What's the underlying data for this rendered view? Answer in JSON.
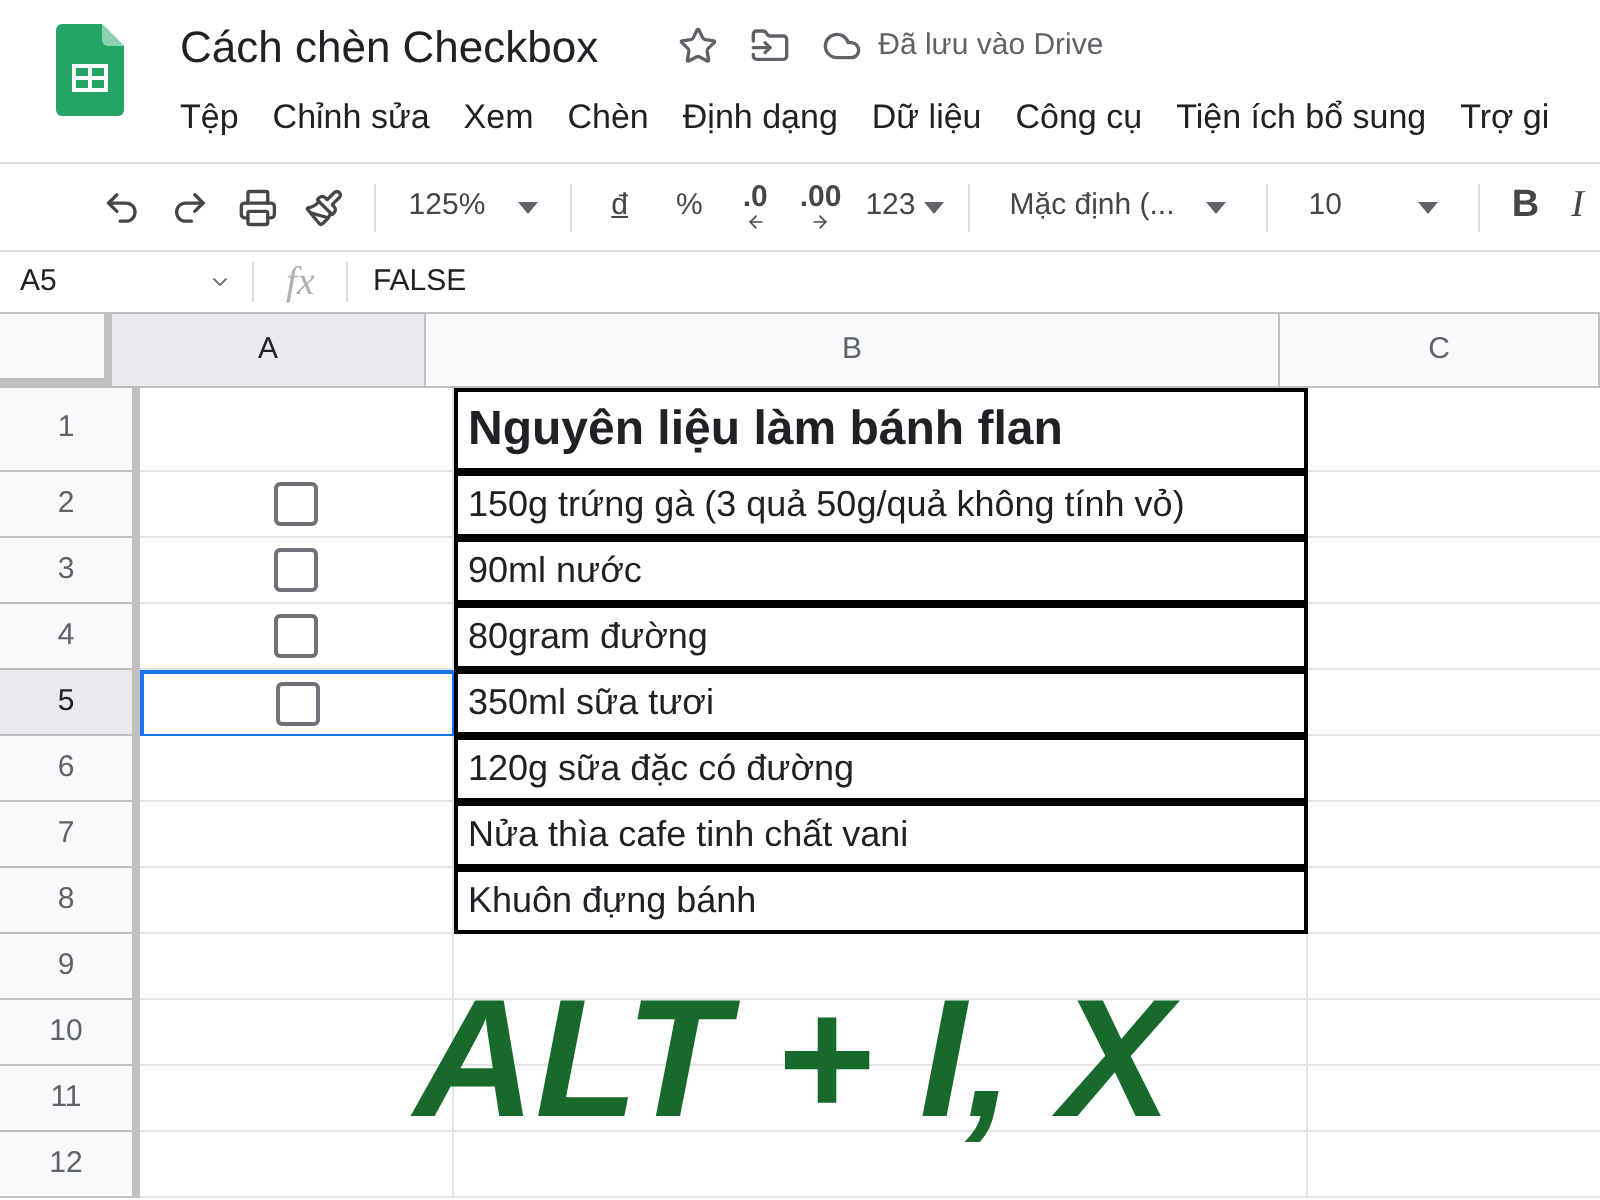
{
  "document": {
    "title": "Cách chèn Checkbox",
    "save_status": "Đã lưu vào Drive"
  },
  "menu": [
    "Tệp",
    "Chỉnh sửa",
    "Xem",
    "Chèn",
    "Định dạng",
    "Dữ liệu",
    "Công cụ",
    "Tiện ích bổ sung",
    "Trợ gi"
  ],
  "toolbar": {
    "zoom": "125%",
    "currency": "đ",
    "percent": "%",
    "decrease_decimal": ".0",
    "increase_decimal": ".00",
    "number_format": "123",
    "font": "Mặc định (...",
    "font_size": "10",
    "bold": "B",
    "italic": "I"
  },
  "formula_bar": {
    "cell_ref": "A5",
    "fx": "fx",
    "value": "FALSE"
  },
  "columns": [
    {
      "label": "A",
      "selected": true
    },
    {
      "label": "B",
      "selected": false
    },
    {
      "label": "C",
      "selected": false
    }
  ],
  "rows": [
    {
      "number": "1",
      "kind": "empty",
      "b": "Nguyên liệu làm bánh flan",
      "header": true,
      "selected": false
    },
    {
      "number": "2",
      "kind": "checkbox",
      "checked": false,
      "b": "150g trứng gà (3 quả 50g/quả không tính vỏ)",
      "header": false,
      "selected": false
    },
    {
      "number": "3",
      "kind": "checkbox",
      "checked": false,
      "b": "90ml nước",
      "header": false,
      "selected": false
    },
    {
      "number": "4",
      "kind": "checkbox",
      "checked": false,
      "b": "80gram đường",
      "header": false,
      "selected": false
    },
    {
      "number": "5",
      "kind": "checkbox",
      "checked": false,
      "b": "350ml sữa tươi",
      "header": false,
      "selected": true
    },
    {
      "number": "6",
      "kind": "empty",
      "b": "120g sữa đặc có đường",
      "header": false,
      "selected": false
    },
    {
      "number": "7",
      "kind": "empty",
      "b": "Nửa thìa cafe tinh chất vani",
      "header": false,
      "selected": false
    },
    {
      "number": "8",
      "kind": "empty",
      "b": "Khuôn đựng bánh",
      "header": false,
      "selected": false
    },
    {
      "number": "9",
      "header": false,
      "selected": false
    },
    {
      "number": "10",
      "header": false,
      "selected": false
    },
    {
      "number": "11",
      "header": false,
      "selected": false
    },
    {
      "number": "12",
      "header": false,
      "selected": false
    }
  ],
  "overlay_caption": "ALT + I, X"
}
